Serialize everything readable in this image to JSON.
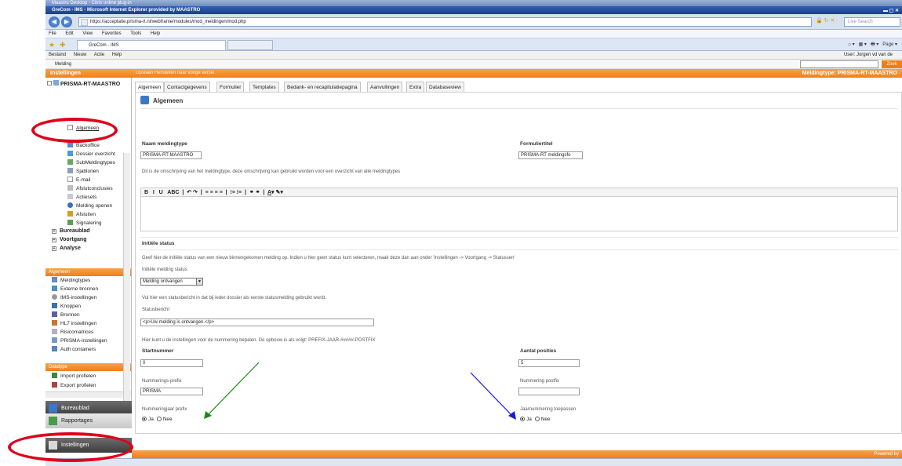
{
  "window": {
    "citrix_title": "Maastro Desktop - Citrix online plug-in",
    "ie_title": "GreCom - IMS - Microsoft Internet Explorer provided by MAASTRO",
    "address": "https://acceptatie.prisma-rt.nl/webframe/modules/mod_meldingen/mod.php",
    "live_search_placeholder": "Live Search",
    "menu": [
      "File",
      "Edit",
      "View",
      "Favorites",
      "Tools",
      "Help"
    ],
    "tab_title": "GreCom - IMS",
    "command_bar": "Page"
  },
  "app": {
    "menu": [
      "Bestand",
      "Nieuw",
      "Actie",
      "Help"
    ],
    "user": "User: Jorgen vd van de",
    "breadcrumb": "Melding",
    "search_button": "Zoek",
    "header_section": "Instellingen",
    "header_actions": "Opslaan  Herstellen naar vorige versie",
    "header_meldingtype": "Meldingtype: PRISMA-RT-MAASTRO"
  },
  "sidebar": {
    "root": "PRISMA-RT-MAASTRO",
    "items": [
      "Algemeen",
      "Backoffice",
      "Dossier overzicht",
      "SubMeldingtypes",
      "Sjablonen",
      "E-mail",
      "Afslutconclusies",
      "Actiesets",
      "Melding openen",
      "Afsluiten",
      "Signalering"
    ],
    "groups": [
      "Bureaublad",
      "Voortgang",
      "Analyse"
    ],
    "algemeen_head": "Algemeen",
    "algemeen_items": [
      "Meldingtypes",
      "Externe bronnen",
      "IMS-instellingen",
      "Knoppen",
      "Bronnen",
      "HL7 instellingen",
      "Risicomatrices",
      "PRISMA-instellingen",
      "Auth containers"
    ],
    "datatype_head": "Datatype",
    "datatype_items": [
      "Import profielen",
      "Export profielen"
    ],
    "tiles": [
      "Bureaublad",
      "Rapportages",
      "Instellingen"
    ]
  },
  "tabs": [
    "Algemeen",
    "Contactgegevens",
    "Formulier",
    "Templates",
    "Bedank- en recapitulatiepagina",
    "Aanvullingen",
    "Extra",
    "Databaseview"
  ],
  "form": {
    "section_title": "Algemeen",
    "naam_label": "Naam meldingtype",
    "naam_value": "PRISMA-RT-MAASTRO",
    "formtitel_label": "Formuliertitel",
    "formtitel_value": "PRISMA-RT meldingsfo",
    "omschrijving_help": "Dit is de omschrijving van het meldingtype, deze omschrijving kan gebruikt worden voor een overzicht van alle meldingtypes",
    "initiele_title": "Initiële status",
    "initiele_help": "Geef hier de initiële status van een nieuw binnengekomen melding op. Indien u hier geen status kunt selecteren, maak deze dan aan onder 'Instellingen -> Voortgang -> Statussen'",
    "initiele_label": "Initiële melding status",
    "initiele_value": "Melding ontvangen",
    "statusbericht_help": "Vul hier een statusbericht in dat bij ieder dossier als eerste statusmelding gebruikt wordt.",
    "statusbericht_label": "Statusbericht",
    "statusbericht_value": "<p>Uw melding is ontvangen.</p>",
    "nummering_help": "Hier kunt u de instellingen voor de nummering bepalen. De opbouw is als volgt: PREFIX-JAAR-#####-POSTFIX",
    "startnummer_label": "Startnummer",
    "startnummer_value": "0",
    "aantal_label": "Aantal posities",
    "aantal_value": "5",
    "prefix_label": "Nummerings-prefix",
    "prefix_value": "PRISMA",
    "postfix_label": "Nummering postfix",
    "postfix_value": "",
    "jaarprefix_label": "Nummeringjaar prefix",
    "jaarnummering_label": "Jaarnummering toepassen",
    "ja": "Ja",
    "nee": "Nee"
  },
  "footer": {
    "powered": "Powered by"
  },
  "colors": {
    "accent": "#ef7f1a",
    "annotation_ring": "#e0001b",
    "arrow_green": "#1a8a1a",
    "arrow_blue": "#1a1ae0"
  }
}
